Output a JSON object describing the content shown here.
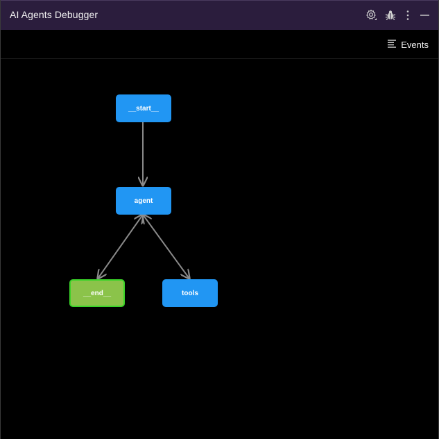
{
  "window": {
    "title": "AI Agents Debugger"
  },
  "titlebar_icons": [
    {
      "name": "settings-icon"
    },
    {
      "name": "bug-icon"
    },
    {
      "name": "more-vertical-icon"
    },
    {
      "name": "minimize-icon"
    }
  ],
  "toolbar": {
    "events_label": "Events",
    "events_icon": "list-icon"
  },
  "graph": {
    "nodes": {
      "start": {
        "label": "__start__",
        "color": "#2196f3"
      },
      "agent": {
        "label": "agent",
        "color": "#2196f3"
      },
      "end": {
        "label": "__end__",
        "color": "#8bc34a",
        "border": "#39d428"
      },
      "tools": {
        "label": "tools",
        "color": "#2196f3"
      }
    },
    "edges": [
      {
        "from": "__start__",
        "to": "agent"
      },
      {
        "from": "agent",
        "to": "__end__"
      },
      {
        "from": "__end__",
        "to": "agent"
      },
      {
        "from": "agent",
        "to": "tools"
      },
      {
        "from": "tools",
        "to": "agent"
      }
    ],
    "edge_color": "#8a8a8a"
  },
  "colors": {
    "titlebar_bg": "#2b1d3d",
    "canvas_bg": "#000000",
    "node_blue": "#2196f3",
    "node_green": "#8bc34a"
  }
}
